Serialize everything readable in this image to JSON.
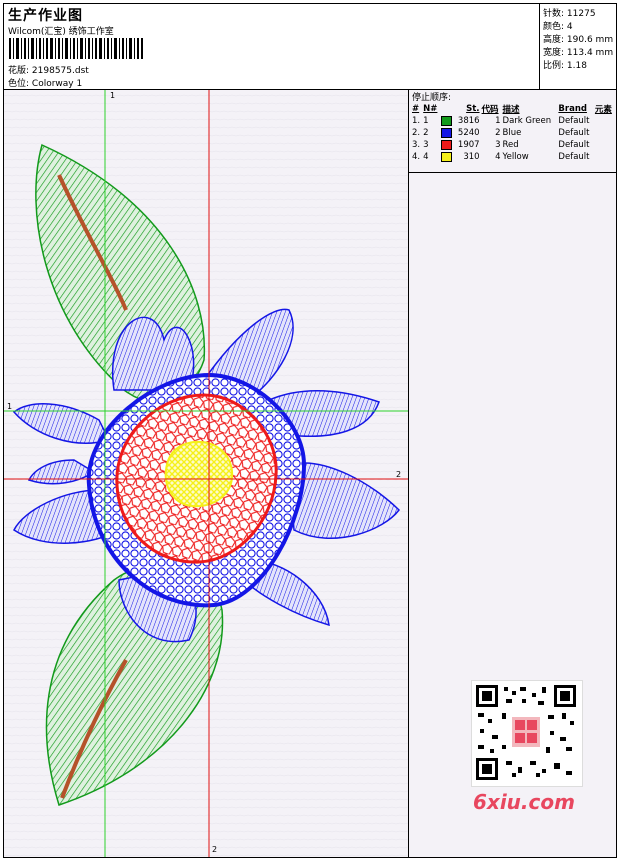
{
  "header": {
    "title": "生产作业图",
    "subtitle": "Wilcom(汇宝) 绣饰工作室",
    "design_label": "花版:",
    "design_value": "2198575.dst",
    "colorway_label": "色位:",
    "colorway_value": "Colorway 1"
  },
  "stats": {
    "stitches_label": "针数:",
    "stitches_value": "11275",
    "colors_label": "颜色:",
    "colors_value": "4",
    "height_label": "高度:",
    "height_value": "190.6 mm",
    "width_label": "宽度:",
    "width_value": "113.4 mm",
    "scale_label": "比例:",
    "scale_value": "1.18"
  },
  "stop_sequence": {
    "title": "停止顺序:",
    "headers": [
      "#",
      "N#",
      "St.",
      "代码",
      "描述",
      "Brand",
      "元素"
    ],
    "rows": [
      {
        "idx": "1.",
        "n": "1",
        "color": "#129a1b",
        "st": "3816",
        "code": "1",
        "desc": "Dark Green",
        "brand": "Default"
      },
      {
        "idx": "2.",
        "n": "2",
        "color": "#1416e6",
        "st": "5240",
        "code": "2",
        "desc": "Blue",
        "brand": "Default"
      },
      {
        "idx": "3.",
        "n": "3",
        "color": "#ee1a1a",
        "st": "1907",
        "code": "3",
        "desc": "Red",
        "brand": "Default"
      },
      {
        "idx": "4.",
        "n": "4",
        "color": "#f5f01a",
        "st": "310",
        "code": "4",
        "desc": "Yellow",
        "brand": "Default"
      }
    ]
  },
  "axes": {
    "top_label": "1",
    "left_label": "1",
    "right_label": "2",
    "bottom_label": "2"
  },
  "colors": {
    "green": "#129a1b",
    "blue": "#1416e6",
    "red": "#ee1a1a",
    "yellow": "#f5f01a",
    "stem": "#b5522a",
    "axis_green": "#2bd12b",
    "axis_red": "#e01010"
  },
  "watermark": "6xiu.com",
  "qr_icon": "qr-code-icon"
}
